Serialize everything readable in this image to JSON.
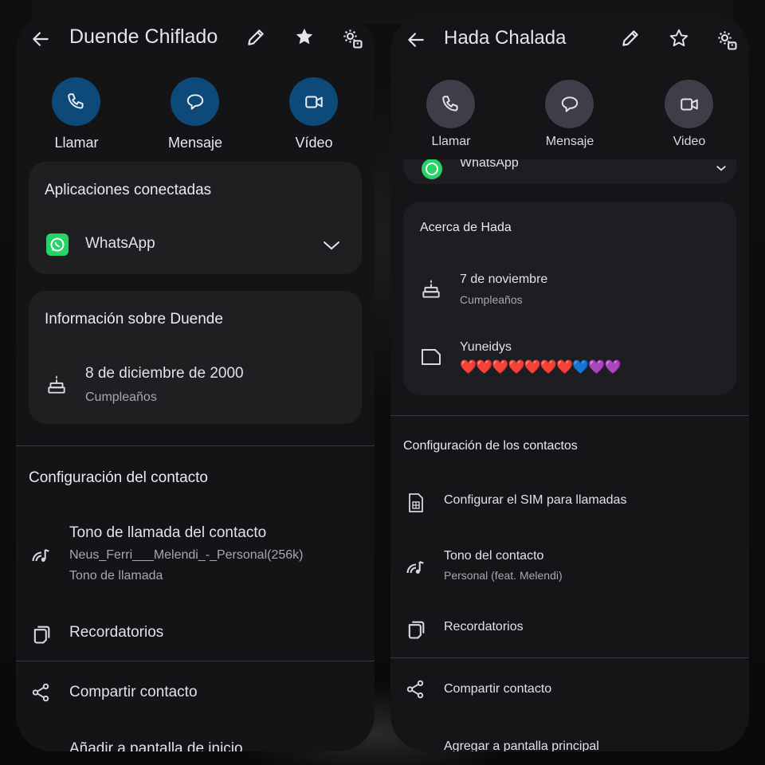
{
  "left": {
    "title": "Duende Chiflado",
    "actions": [
      "Llamar",
      "Mensaje",
      "Vídeo"
    ],
    "connected_apps": {
      "title": "Aplicaciones conectadas",
      "app": "WhatsApp"
    },
    "info": {
      "title": "Información sobre Duende",
      "birthday": "8 de diciembre de 2000",
      "birthday_label": "Cumpleaños"
    },
    "settings": {
      "title": "Configuración del contacto",
      "ringtone_title": "Tono de llamada del contacto",
      "ringtone_value": "Neus_Ferri___Melendi_-_Personal(256k)",
      "ringtone_label": "Tono de llamada",
      "reminders": "Recordatorios"
    },
    "share": "Compartir contacto",
    "add_home": "Añadir a pantalla de inicio"
  },
  "right": {
    "title": "Hada Chalada",
    "actions": [
      "Llamar",
      "Mensaje",
      "Video"
    ],
    "connected_app_partial": "WhatsApp",
    "about": {
      "title": "Acerca de Hada",
      "birthday": "7 de noviembre",
      "birthday_label": "Cumpleaños",
      "note_title": "Yuneidys",
      "note_value": "❤️❤️❤️❤️❤️❤️❤️💙💜💜"
    },
    "settings": {
      "title": "Configuración de los contactos",
      "sim": "Configurar el SIM para llamadas",
      "tone_title": "Tono del contacto",
      "tone_value": "Personal (feat. Melendi)",
      "reminders": "Recordatorios"
    },
    "share": "Compartir contacto",
    "add_home": "Agregar a pantalla principal"
  },
  "colors": {
    "left_action_bg": "#0d4a7a",
    "right_action_bg": "#3f3d48",
    "whatsapp_green": "#25d366",
    "panel_bg": "#141416",
    "card_bg": "#1f1f22"
  },
  "icons": [
    "back-arrow-icon",
    "edit-icon",
    "star-icon",
    "contact-settings-icon",
    "phone-icon",
    "message-icon",
    "video-icon",
    "whatsapp-icon",
    "chevron-down-icon",
    "cake-icon",
    "note-icon",
    "sim-icon",
    "ringtone-icon",
    "reminders-icon",
    "share-icon"
  ]
}
